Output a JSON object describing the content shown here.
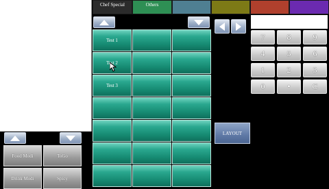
{
  "categories": [
    {
      "label": "Chef Special",
      "color": "#2b2b2b"
    },
    {
      "label": "Others",
      "color": "#2e8f54"
    },
    {
      "label": "",
      "color": "#4f7f92"
    },
    {
      "label": "",
      "color": "#7d7a16"
    },
    {
      "label": "",
      "color": "#b0402d"
    },
    {
      "label": "",
      "color": "#6b2ab0"
    }
  ],
  "items": {
    "rows": [
      [
        "Test 1",
        "",
        ""
      ],
      [
        "Test 2",
        "",
        ""
      ],
      [
        "Test 3",
        "",
        ""
      ],
      [
        "",
        "",
        ""
      ],
      [
        "",
        "",
        ""
      ],
      [
        "",
        "",
        ""
      ],
      [
        "",
        "",
        ""
      ]
    ]
  },
  "keypad": {
    "keys": [
      "7",
      "8",
      "9",
      "4",
      "5",
      "6",
      "1",
      "2",
      "3",
      "0",
      "•",
      "C"
    ]
  },
  "modifiers": {
    "buttons": [
      "Food Modi",
      "ToGo",
      "Drink Modi",
      "Spicy"
    ]
  },
  "layout_button": "LAYOUT",
  "icons": {
    "up": "up-arrow-icon",
    "down": "down-arrow-icon",
    "left": "left-arrow-icon",
    "right": "right-arrow-icon"
  }
}
